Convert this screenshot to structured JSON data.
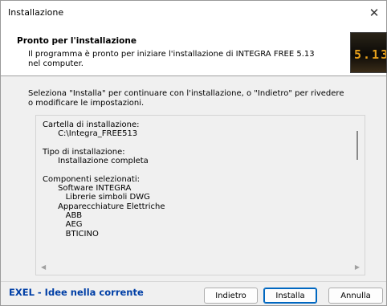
{
  "window": {
    "title": "Installazione",
    "close_glyph": "✕"
  },
  "header": {
    "title": "Pronto per l'installazione",
    "subtitle": "Il programma è pronto per iniziare l'installazione di INTEGRA FREE 5.13 nel computer.",
    "logo_text": "5.13"
  },
  "intro": "Seleziona \"Installa\" per continuare con l'installazione, o \"Indietro\" per rivedere o modificare le impostazioni.",
  "memo": {
    "lines": [
      "Cartella di installazione:",
      "      C:\\Integra_FREE513",
      "",
      "Tipo di installazione:",
      "      Installazione completa",
      "",
      "Componenti selezionati:",
      "      Software INTEGRA",
      "         Librerie simboli DWG",
      "      Apparecchiature Elettriche",
      "         ABB",
      "         AEG",
      "         BTICINO"
    ],
    "scroll_left_glyph": "◀",
    "scroll_right_glyph": "▶"
  },
  "footer": {
    "brand": "EXEL - Idee nella corrente",
    "back_label": "Indietro",
    "install_label": "Installa",
    "cancel_label": "Annulla"
  }
}
